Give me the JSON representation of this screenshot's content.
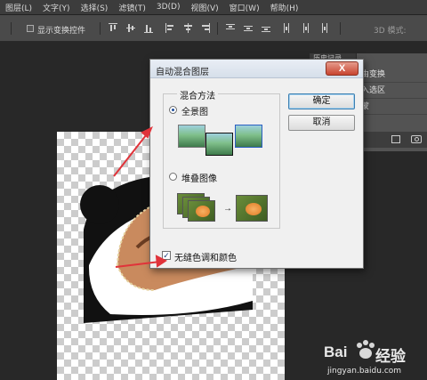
{
  "menu": {
    "items": [
      "图层(L)",
      "文字(Y)",
      "选择(S)",
      "滤镜(T)",
      "3D(D)",
      "视图(V)",
      "窗口(W)",
      "帮助(H)"
    ]
  },
  "options_bar": {
    "show_transform_label": "显示变换控件",
    "mode_label": "3D 模式:"
  },
  "panel": {
    "tab_label": "历史记录",
    "rows": [
      "由变换",
      "入选区",
      "蒙"
    ]
  },
  "dialog": {
    "title": "自动混合图层",
    "close_glyph": "X",
    "group_label": "混合方法",
    "option_panorama": "全景图",
    "option_stack": "堆叠图像",
    "ok_label": "确定",
    "cancel_label": "取消",
    "checkbox_label": "无缝色调和颜色",
    "checkbox_checked": true,
    "panorama_selected": true
  },
  "watermark": {
    "brand": "Bai",
    "brand2": "经验",
    "url": "jingyan.baidu.com"
  },
  "colors": {
    "arrow": "#e0333a",
    "dialog_bg": "#f0f0f0",
    "panel_bg": "#535353",
    "app_bg": "#282828"
  }
}
